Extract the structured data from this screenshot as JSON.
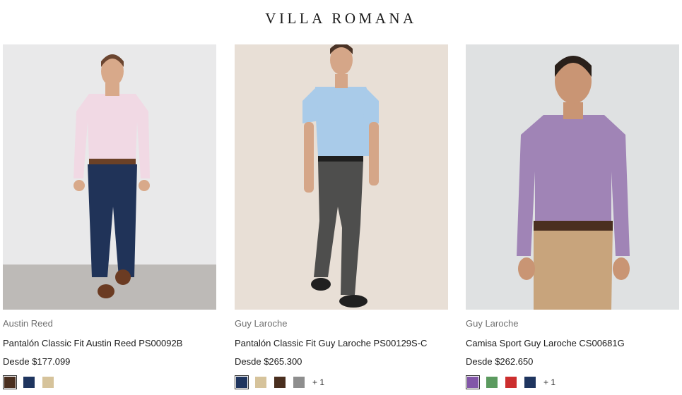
{
  "header": {
    "brand_logo": "VILLA ROMANA"
  },
  "products": [
    {
      "brand": "Austin Reed",
      "title": "Pantalón Classic Fit Austin Reed PS00092B",
      "price": "Desde $177.099",
      "colors": [
        "#4a2f1f",
        "#1f355f",
        "#d6c39b"
      ],
      "more": ""
    },
    {
      "brand": "Guy Laroche",
      "title": "Pantalón Classic Fit Guy Laroche PS00129S-C",
      "price": "Desde $265.300",
      "colors": [
        "#1f355f",
        "#d6c39b",
        "#4a2f1f",
        "#8e8e8e"
      ],
      "more": "+ 1"
    },
    {
      "brand": "Guy Laroche",
      "title": "Camisa Sport Guy Laroche CS00681G",
      "price": "Desde $262.650",
      "colors": [
        "#8256a8",
        "#5b9a5f",
        "#cc2e2e",
        "#1f355f"
      ],
      "more": "+ 1"
    }
  ]
}
